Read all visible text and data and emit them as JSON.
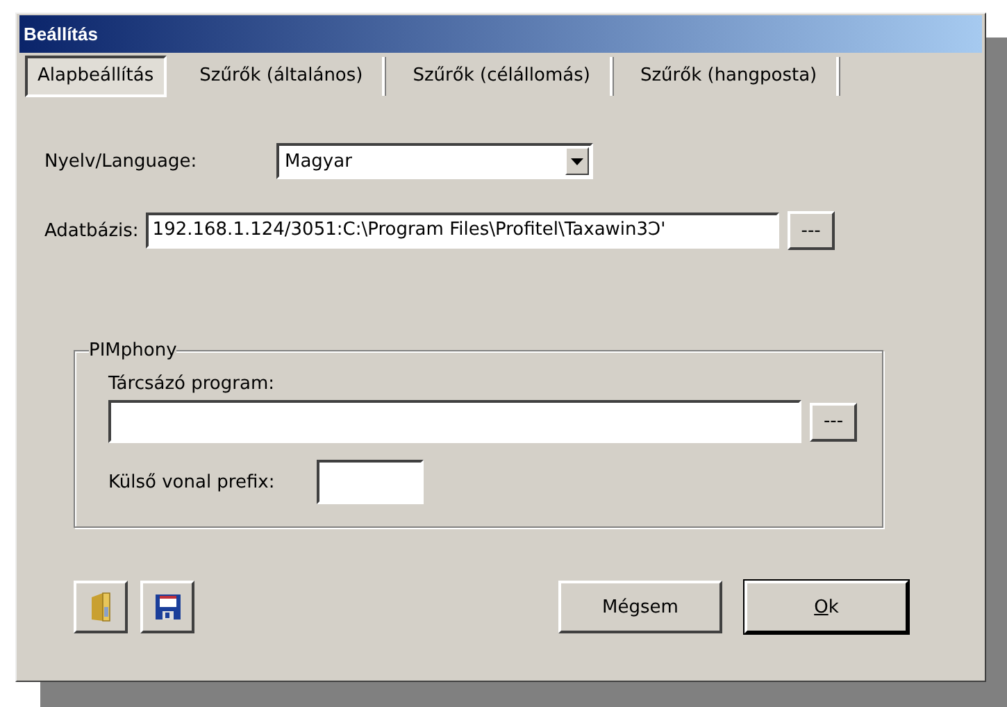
{
  "window": {
    "title": "Beállítás"
  },
  "tabs": [
    {
      "label": "Alapbeállítás",
      "selected": true
    },
    {
      "label": "Szűrők (általános)",
      "selected": false
    },
    {
      "label": "Szűrők (célállomás)",
      "selected": false
    },
    {
      "label": "Szűrők (hangposta)",
      "selected": false
    }
  ],
  "language": {
    "label": "Nyelv/Language:",
    "value": "Magyar"
  },
  "database": {
    "label": "Adatbázis:",
    "value": "192.168.1.124/3051:C:\\Program Files\\Profitel\\Taxawin3Ↄ'",
    "browse": "---"
  },
  "group": {
    "title": "PIMphony",
    "dialer_label": "Tárcsázó program:",
    "dialer_browse": "---",
    "prefix_label": "Külső vonal prefix:"
  },
  "buttons": [
    {
      "label": "Mégsem",
      "default": false
    },
    {
      "label": "Ok",
      "default": true
    }
  ]
}
